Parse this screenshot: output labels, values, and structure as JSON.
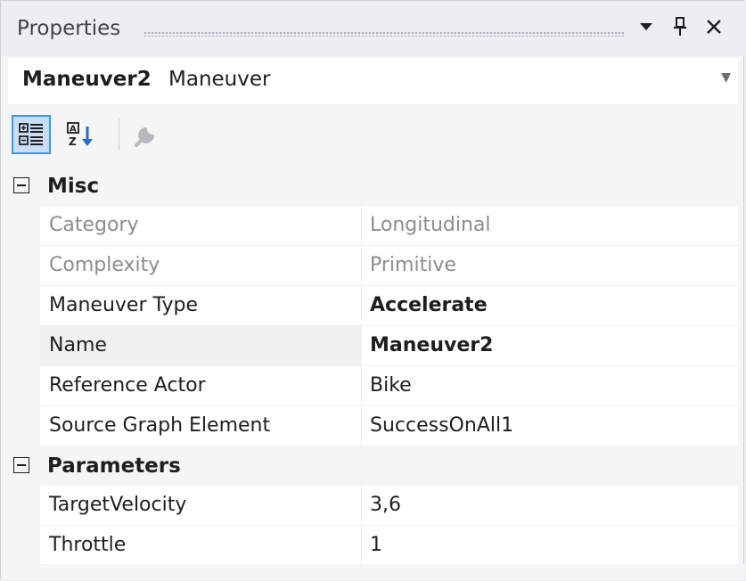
{
  "window": {
    "title": "Properties"
  },
  "object_selector": {
    "name": "Maneuver2",
    "type": "Maneuver"
  },
  "toolbar": {
    "buttons": [
      {
        "icon": "categorized-icon",
        "active": true
      },
      {
        "icon": "alphabetical-sort-icon",
        "active": false
      },
      {
        "icon": "property-pages-wrench-icon",
        "active": false
      }
    ]
  },
  "categories": [
    {
      "label": "Misc",
      "properties": [
        {
          "name": "Category",
          "value": "Longitudinal",
          "readonly": true
        },
        {
          "name": "Complexity",
          "value": "Primitive",
          "readonly": true
        },
        {
          "name": "Maneuver Type",
          "value": "Accelerate",
          "bold": true
        },
        {
          "name": "Name",
          "value": "Maneuver2",
          "bold": true,
          "selected": true
        },
        {
          "name": "Reference Actor",
          "value": "Bike"
        },
        {
          "name": "Source Graph Element",
          "value": "SuccessOnAll1"
        }
      ]
    },
    {
      "label": "Parameters",
      "properties": [
        {
          "name": "TargetVelocity",
          "value": "3,6"
        },
        {
          "name": "Throttle",
          "value": "1"
        }
      ]
    }
  ]
}
